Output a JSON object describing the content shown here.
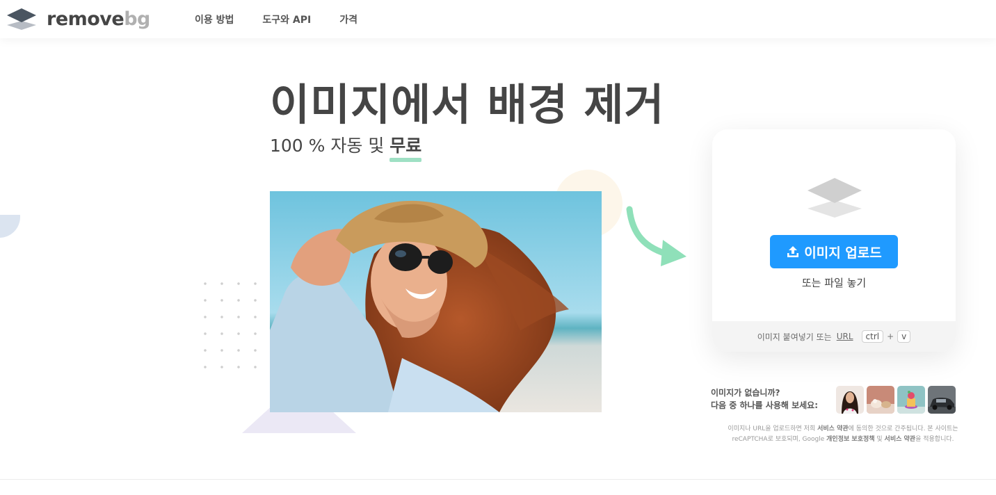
{
  "header": {
    "logo_main": "remove",
    "logo_accent": "bg",
    "nav": [
      "이용 방법",
      "도구와 API",
      "가격"
    ]
  },
  "hero": {
    "title": "이미지에서 배경 제거",
    "subtitle_prefix": "100 % 자동 및 ",
    "subtitle_emphasis": "무료"
  },
  "upload_card": {
    "upload_button_label": "이미지 업로드",
    "drop_text": "또는 파일 놓기",
    "paste_text": "이미지 붙여넣기 또는",
    "url_link": "URL",
    "shortcut_key1": "ctrl",
    "shortcut_plus": "+",
    "shortcut_key2": "v"
  },
  "samples": {
    "line1": "이미지가 없습니까?",
    "line2": "다음 중 하나를 사용해 보세요:",
    "thumbnails": [
      "woman-sample",
      "animals-sample",
      "cake-sample",
      "car-sample"
    ]
  },
  "legal": {
    "part1": "이미지나 URL을 업로드하면 저희 ",
    "terms1": "서비스 약관",
    "part2": "에 동의한 것으로 간주됩니다. 본 사이트는 reCAPTCHA로 보호되며, Google ",
    "privacy": "개인정보 보호정책",
    "part3": " 및 ",
    "terms2": "서비스 약관",
    "part4": "을 적용합니다."
  },
  "colors": {
    "accent_blue": "#1f9aff",
    "underline_green": "#9fe0c4",
    "arrow_green": "#8fe0b9",
    "text_dark": "#454545"
  }
}
